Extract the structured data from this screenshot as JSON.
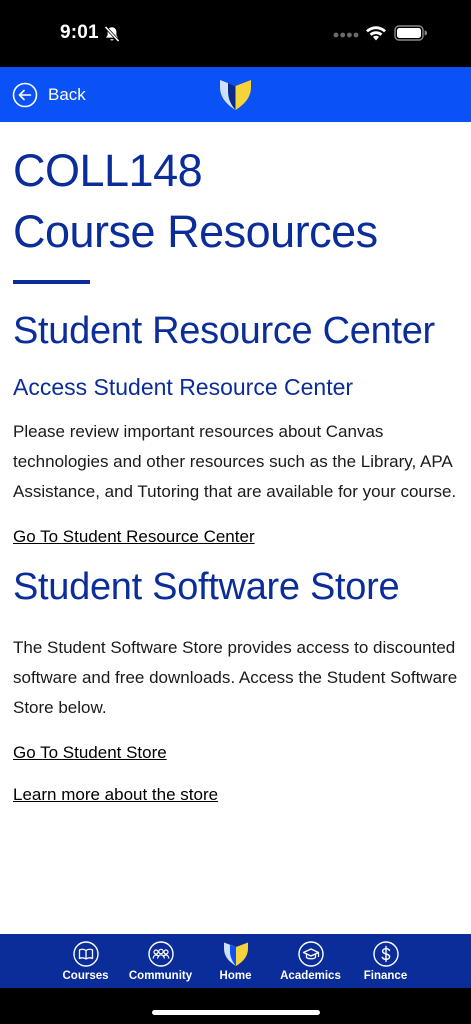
{
  "status_bar": {
    "time": "9:01",
    "icons": [
      "bell-slash-icon",
      "signal-dots-icon",
      "wifi-icon",
      "battery-icon"
    ]
  },
  "top_nav": {
    "back_label": "Back",
    "back_icon": "arrow-left-circle-icon",
    "logo_icon": "shield-logo-icon"
  },
  "content": {
    "title_line1": "COLL148",
    "title_line2": "Course Resources",
    "sections": [
      {
        "title": "Student Resource Center",
        "subheading": "Access Student Resource Center",
        "body": "Please review important resources about Canvas technologies and other resources such as the Library, APA Assistance, and Tutoring that are available for your course.",
        "links": [
          "Go To Student Resource Center"
        ]
      },
      {
        "title": "Student Software Store",
        "body": "The Student Software Store provides access to discounted software and free downloads. Access the Student Software Store below.",
        "links": [
          "Go To Student Store",
          "Learn more about the store"
        ]
      }
    ]
  },
  "tab_bar": {
    "tabs": [
      {
        "label": "Courses",
        "icon": "book-icon"
      },
      {
        "label": "Community",
        "icon": "people-icon"
      },
      {
        "label": "Home",
        "icon": "shield-logo-icon"
      },
      {
        "label": "Academics",
        "icon": "graduation-cap-icon"
      },
      {
        "label": "Finance",
        "icon": "dollar-icon"
      }
    ]
  },
  "colors": {
    "nav_blue": "#0a52f5",
    "heading_navy": "#0b2d9a",
    "tab_bar_navy": "#0b2d9a",
    "logo_yellow": "#f5d33a",
    "logo_light_blue": "#cfe0ff"
  }
}
